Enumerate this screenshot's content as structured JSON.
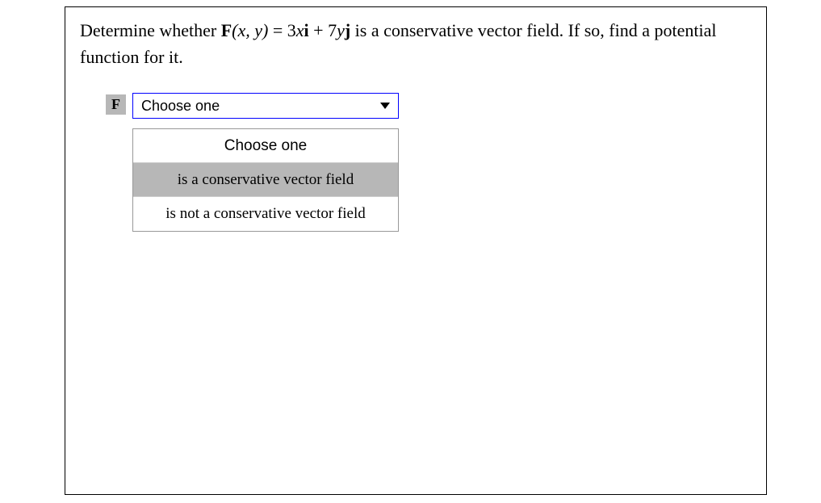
{
  "question": {
    "prefix": "Determine whether ",
    "vector_name": "F",
    "args": "(x, y)",
    "equals": " = 3x",
    "unit_i": "i",
    "plus": " + 7y",
    "unit_j": "j",
    "suffix": " is a conservative vector field. If so, find a potential function for it."
  },
  "dropdown": {
    "label": "F",
    "selected": "Choose one",
    "options": {
      "header": "Choose one",
      "opt1": "is a conservative vector field",
      "opt2": "is not a conservative vector field"
    }
  }
}
